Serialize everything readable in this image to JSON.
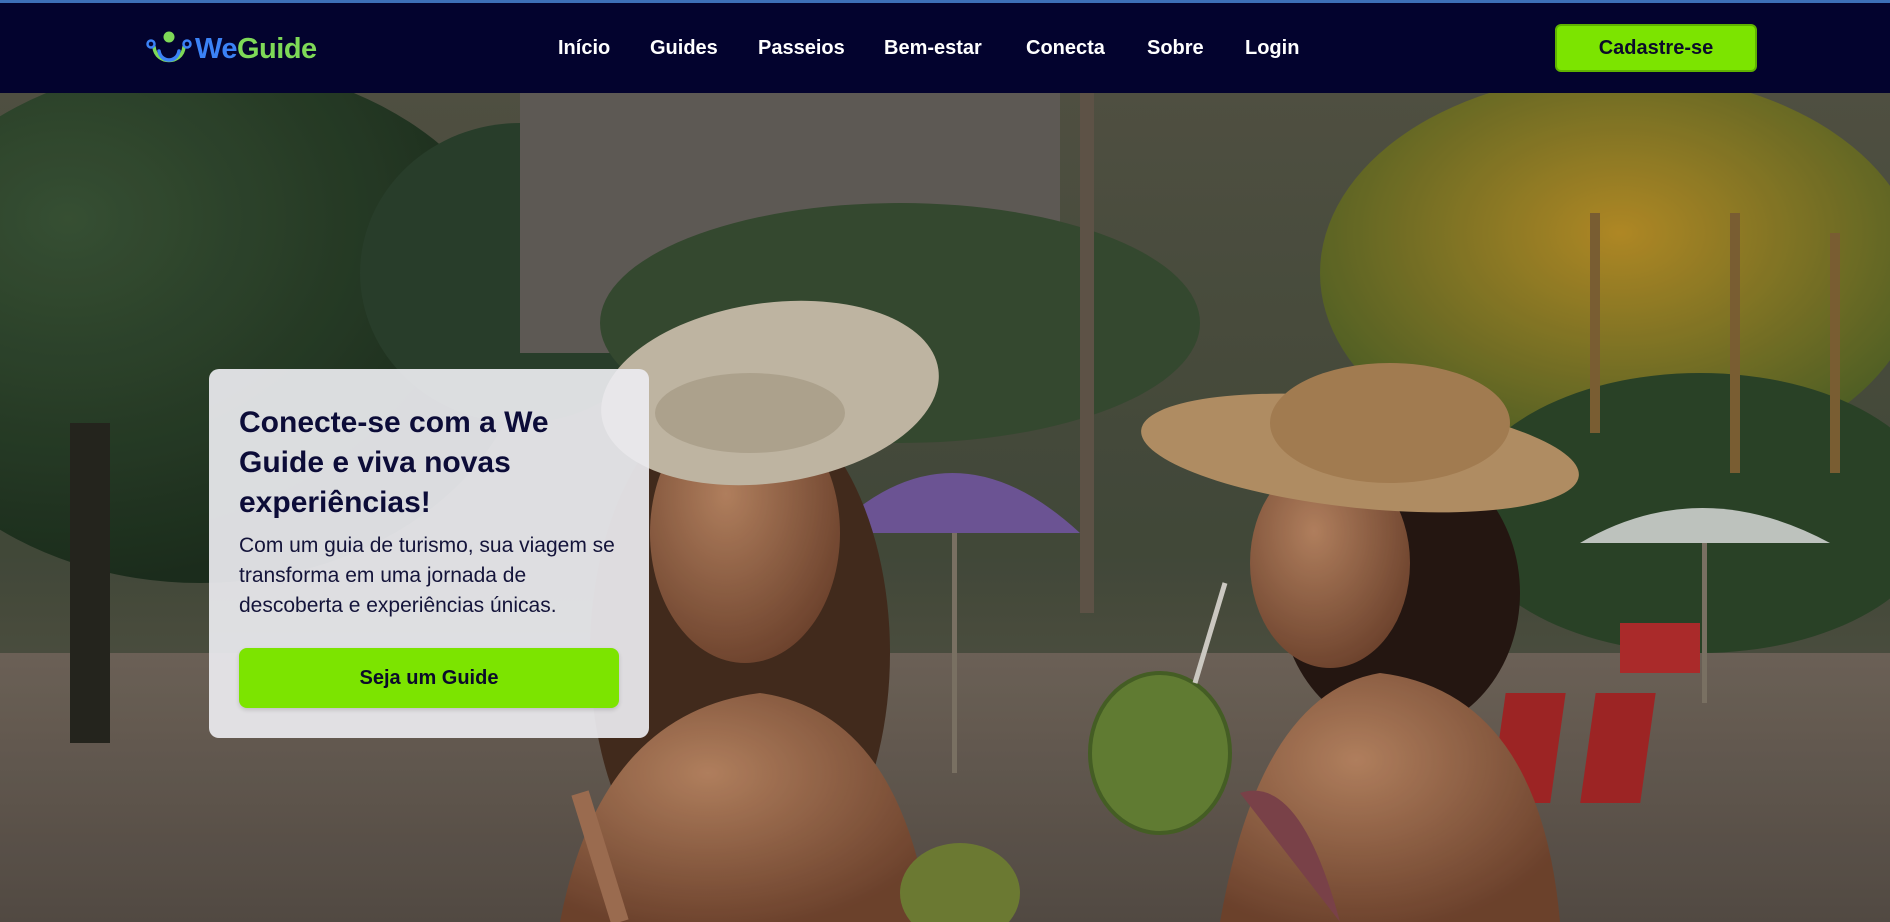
{
  "brand": {
    "name_part1": "We",
    "name_part2": "Guide",
    "colors": {
      "we": "#3b82f6",
      "guide": "#7ed957"
    }
  },
  "nav": {
    "items": [
      {
        "label": "Início"
      },
      {
        "label": "Guides"
      },
      {
        "label": "Passeios"
      },
      {
        "label": "Bem-estar"
      },
      {
        "label": "Conecta"
      },
      {
        "label": "Sobre"
      },
      {
        "label": "Login"
      }
    ],
    "cta_label": "Cadastre-se"
  },
  "hero": {
    "title": "Conecte-se com a We Guide e viva novas experiências!",
    "text": "Com um guia de turismo, sua viagem se transforma em uma jornada de descoberta e experiências únicas.",
    "button_label": "Seja um Guide"
  },
  "colors": {
    "navbar": "#03032e",
    "accent": "#7ce400",
    "card": "#ececf0"
  }
}
